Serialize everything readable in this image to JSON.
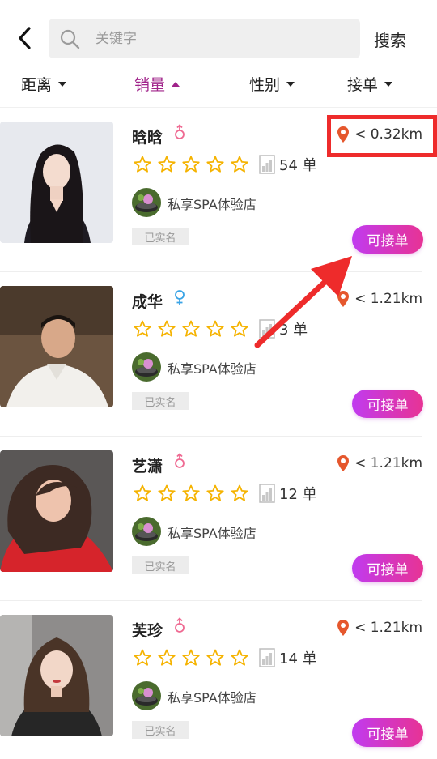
{
  "header": {
    "search_placeholder": "关键字",
    "search_label": "搜索"
  },
  "filters": [
    {
      "label": "距离",
      "active": false
    },
    {
      "label": "销量",
      "active": true
    },
    {
      "label": "性别",
      "active": false
    },
    {
      "label": "接单",
      "active": false
    }
  ],
  "colors": {
    "accent": "#a0238a",
    "button_gradient_start": "#c03bf0",
    "button_gradient_end": "#e73395",
    "highlight": "#ee2b2b",
    "star": "#f5b301",
    "pin": "#e5572d"
  },
  "therapists": [
    {
      "name": "晗晗",
      "gender": "female",
      "distance": "< 0.32km",
      "orders": "54 单",
      "shop": "私享SPA体验店",
      "verified": "已实名",
      "accept": "可接单",
      "stars": 5
    },
    {
      "name": "成华",
      "gender": "male",
      "distance": "< 1.21km",
      "orders": "3 单",
      "shop": "私享SPA体验店",
      "verified": "已实名",
      "accept": "可接单",
      "stars": 5
    },
    {
      "name": "艺潇",
      "gender": "female",
      "distance": "< 1.21km",
      "orders": "12 单",
      "shop": "私享SPA体验店",
      "verified": "已实名",
      "accept": "可接单",
      "stars": 5
    },
    {
      "name": "芙珍",
      "gender": "female",
      "distance": "< 1.21km",
      "orders": "14 单",
      "shop": "私享SPA体验店",
      "verified": "已实名",
      "accept": "可接单",
      "stars": 5
    }
  ]
}
